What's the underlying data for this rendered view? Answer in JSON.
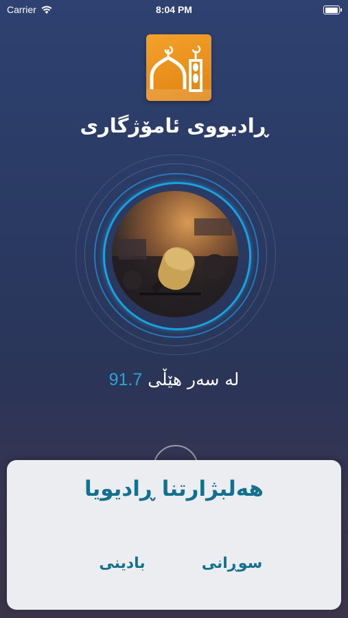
{
  "status_bar": {
    "carrier": "Carrier",
    "time": "8:04 PM"
  },
  "app": {
    "title": "ڕادیووی ئامۆژگاری"
  },
  "player": {
    "frequency_prefix": "لە سەر هێڵی",
    "frequency_value": "91.7"
  },
  "sheet": {
    "title": "هەلبژارتنا ڕادیویا",
    "options": [
      {
        "label": "سوڕانی"
      },
      {
        "label": "بادینی"
      }
    ]
  },
  "colors": {
    "accent": "#1aa2e0",
    "sheet_text": "#13708f",
    "logo": "#f39a22"
  },
  "icons": [
    "wifi-icon",
    "battery-icon",
    "mosque-logo-icon"
  ]
}
